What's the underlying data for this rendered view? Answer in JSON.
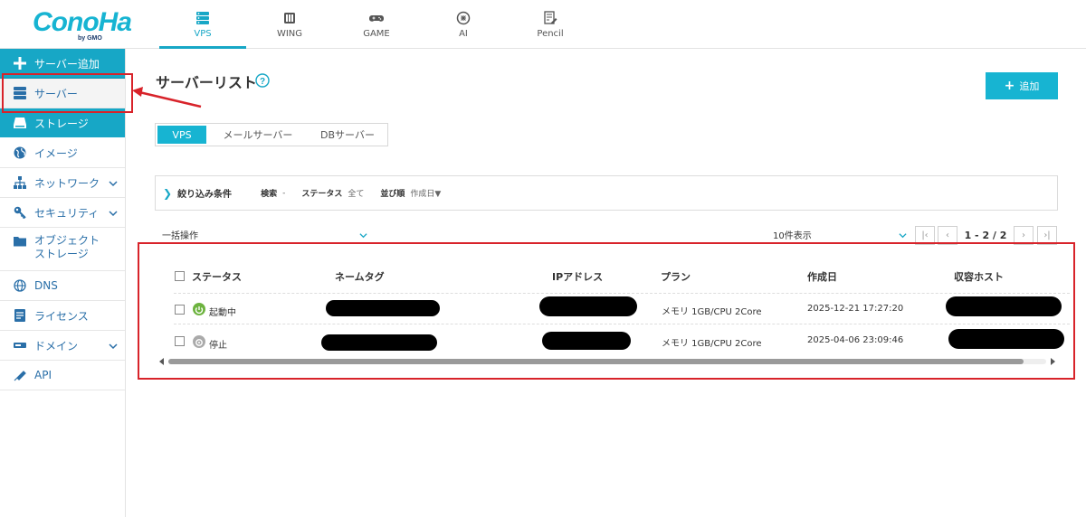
{
  "brand": {
    "name": "ConoHa",
    "by": "by GMO"
  },
  "nav": [
    {
      "label": "VPS",
      "icon": "server-icon",
      "active": true
    },
    {
      "label": "WING",
      "icon": "wing-icon",
      "active": false
    },
    {
      "label": "GAME",
      "icon": "gamepad-icon",
      "active": false
    },
    {
      "label": "AI",
      "icon": "ai-icon",
      "active": false
    },
    {
      "label": "Pencil",
      "icon": "pencil-icon",
      "active": false
    }
  ],
  "sidebar": {
    "items": [
      {
        "label": "サーバー追加",
        "icon": "plus-icon"
      },
      {
        "label": "サーバー",
        "icon": "server-icon"
      },
      {
        "label": "ストレージ",
        "icon": "storage-icon"
      },
      {
        "label": "イメージ",
        "icon": "globe-icon"
      },
      {
        "label": "ネットワーク",
        "icon": "network-icon"
      },
      {
        "label": "セキュリティ",
        "icon": "key-icon"
      },
      {
        "label": "オブジェクト",
        "label2": "ストレージ",
        "icon": "folder-icon"
      },
      {
        "label": "DNS",
        "icon": "dns-icon"
      },
      {
        "label": "ライセンス",
        "icon": "license-icon"
      },
      {
        "label": "ドメイン",
        "icon": "domain-icon"
      },
      {
        "label": "API",
        "icon": "api-icon"
      }
    ]
  },
  "main": {
    "title": "サーバーリスト",
    "add_label": "追加",
    "tabs": [
      "VPS",
      "メールサーバー",
      "DBサーバー"
    ],
    "filter": {
      "label": "絞り込み条件",
      "search_key": "検索",
      "search_value": "-",
      "status_key": "ステータス",
      "status_value": "全て",
      "sort_key": "並び順",
      "sort_value": "作成日▼"
    },
    "bulk_action": "一括操作",
    "per_page": "10件表示",
    "pager": {
      "first": "|‹",
      "prev": "‹",
      "info": "1 - 2 / 2",
      "next": "›",
      "last": "›|"
    },
    "table": {
      "headers": [
        "ステータス",
        "ネームタグ",
        "IPアドレス",
        "プラン",
        "作成日",
        "収容ホスト"
      ],
      "rows": [
        {
          "status": "起動中",
          "status_color": "#6db33f",
          "plan": "メモリ 1GB/CPU 2Core",
          "created": "2025-12-21 17:27:20"
        },
        {
          "status": "停止",
          "status_color": "#aaaaaa",
          "plan": "メモリ 1GB/CPU 2Core",
          "created": "2025-04-06 23:09:46"
        }
      ]
    }
  },
  "colors": {
    "accent": "#17b4d2",
    "annotation": "#d8232a"
  }
}
